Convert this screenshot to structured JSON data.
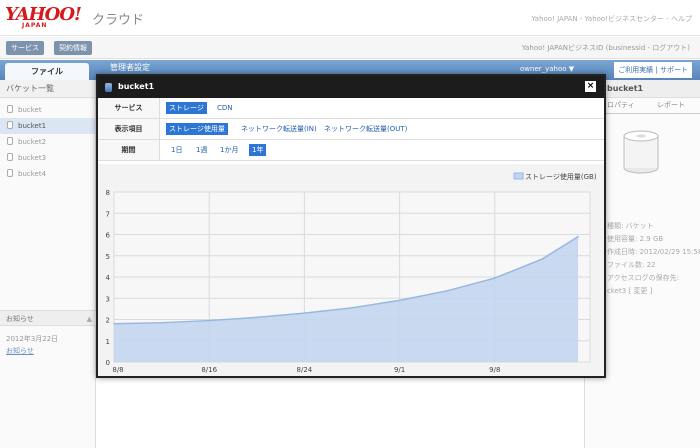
{
  "header": {
    "logo": "YAHOO!",
    "logo_sub": "JAPAN",
    "app_name": "クラウド",
    "top_links": "Yahoo! JAPAN - Yahoo!ビジネスセンター - ヘルプ"
  },
  "subbar": {
    "service_button": "サービス",
    "contract_button": "契約情報",
    "business_id": "Yahoo! JAPANビジネスID (businessid - ログアウト)"
  },
  "tabs": {
    "files": "ファイル",
    "admin": "管理者設定",
    "owner": "owner_yahoo ▼",
    "usage_links": "ご利用実績 | サポート"
  },
  "left": {
    "title": "バケット一覧",
    "buckets": [
      "bucket",
      "bucket1",
      "bucket2",
      "bucket3",
      "bucket4"
    ],
    "notice_title": "お知らせ",
    "notice_caret": "▲",
    "notice_date": "2012年3月22日",
    "notice_link": "お知らせ"
  },
  "right": {
    "title": "bucket1",
    "tab_properties": "ロパティ",
    "tab_report": "レポート",
    "props": [
      "種類: バケット",
      "使用容量: 2.9 GB",
      "作成日時: 2012/02/29 15:58",
      "ファイル数: 22",
      "",
      "アクセスログの保存先:",
      "cket3 [ 変更 ]"
    ]
  },
  "modal": {
    "title": "bucket1",
    "close": "×",
    "rows": {
      "service_label": "サービス",
      "service_options": [
        "ストレージ",
        "CDN"
      ],
      "item_label": "表示項目",
      "item_options": [
        "ストレージ使用量",
        "ネットワーク転送量(IN)",
        "ネットワーク転送量(OUT)"
      ],
      "period_label": "期間",
      "period_options": [
        "1日",
        "1週",
        "1か月",
        "1年"
      ]
    }
  },
  "chart_data": {
    "type": "area",
    "title": "",
    "legend": "ストレージ使用量(GB)",
    "legend_position": "top-right",
    "x_ticks": [
      "8/8",
      "8/16",
      "8/24",
      "9/1",
      "9/8"
    ],
    "y_ticks": [
      0,
      1,
      2,
      3,
      4,
      5,
      6,
      7,
      8
    ],
    "ylim": [
      0,
      8
    ],
    "grid": true,
    "x": [
      0,
      4,
      8,
      12,
      16,
      20,
      24,
      28,
      32,
      36,
      39
    ],
    "values": [
      1.8,
      1.85,
      1.95,
      2.1,
      2.3,
      2.55,
      2.9,
      3.35,
      3.95,
      4.85,
      5.9
    ],
    "colors": {
      "fill": "#c2d5ee",
      "line": "#97b7e3"
    }
  }
}
